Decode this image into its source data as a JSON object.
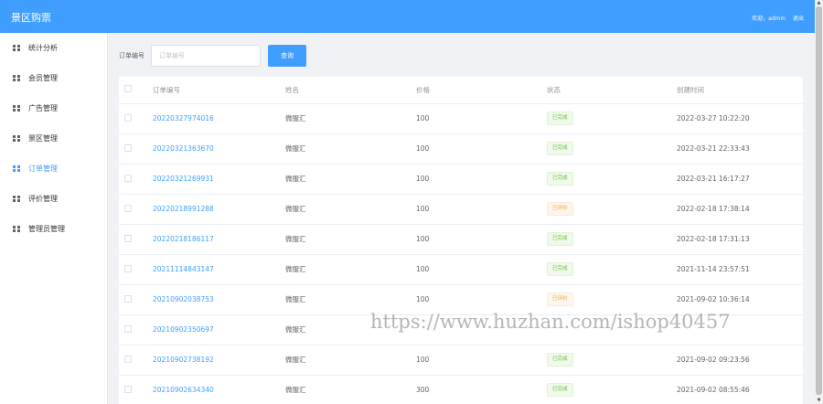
{
  "header": {
    "app_title": "景区购票",
    "welcome": "欢迎，admin",
    "logout": "退出"
  },
  "sidebar": {
    "items": [
      {
        "label": "统计分析",
        "icon": "grid-icon",
        "active": false
      },
      {
        "label": "会员管理",
        "icon": "grid-icon",
        "active": false
      },
      {
        "label": "广告管理",
        "icon": "grid-icon",
        "active": false
      },
      {
        "label": "景区管理",
        "icon": "grid-icon",
        "active": false
      },
      {
        "label": "订单管理",
        "icon": "grid-icon",
        "active": true
      },
      {
        "label": "评价管理",
        "icon": "grid-icon",
        "active": false
      },
      {
        "label": "管理员管理",
        "icon": "grid-icon",
        "active": false
      }
    ]
  },
  "search": {
    "label": "订单编号",
    "placeholder": "订单编号",
    "value": "",
    "button_label": "查询"
  },
  "table": {
    "columns": [
      "订单编号",
      "姓名",
      "价格",
      "状态",
      "创建时间"
    ],
    "rows": [
      {
        "order_no": "20220327974016",
        "name": "微服汇",
        "price": "100",
        "status": "已完成",
        "status_type": "done",
        "created": "2022-03-27 10:22:20"
      },
      {
        "order_no": "20220321363670",
        "name": "微服汇",
        "price": "100",
        "status": "已完成",
        "status_type": "done",
        "created": "2022-03-21 22:33:43"
      },
      {
        "order_no": "20220321269931",
        "name": "微服汇",
        "price": "100",
        "status": "已完成",
        "status_type": "done",
        "created": "2022-03-21 16:17:27"
      },
      {
        "order_no": "20220218991288",
        "name": "微服汇",
        "price": "100",
        "status": "已评价",
        "status_type": "reviewed",
        "created": "2022-02-18 17:38:14"
      },
      {
        "order_no": "20220218186117",
        "name": "微服汇",
        "price": "100",
        "status": "已完成",
        "status_type": "done",
        "created": "2022-02-18 17:31:13"
      },
      {
        "order_no": "20211114843147",
        "name": "微服汇",
        "price": "100",
        "status": "已完成",
        "status_type": "done",
        "created": "2021-11-14 23:57:51"
      },
      {
        "order_no": "20210902038753",
        "name": "微服汇",
        "price": "100",
        "status": "已评价",
        "status_type": "reviewed",
        "created": "2021-09-02 10:36:14"
      },
      {
        "order_no": "20210902350697",
        "name": "微服汇",
        "price": "",
        "status": "",
        "status_type": "done",
        "created": ""
      },
      {
        "order_no": "20210902738192",
        "name": "微服汇",
        "price": "100",
        "status": "已完成",
        "status_type": "done",
        "created": "2021-09-02 09:23:56"
      },
      {
        "order_no": "20210902634340",
        "name": "微服汇",
        "price": "300",
        "status": "已完成",
        "status_type": "done",
        "created": "2021-09-02 08:55:46"
      }
    ]
  },
  "watermark": "https://www.huzhan.com/ishop40457",
  "colors": {
    "primary": "#409eff",
    "success": "#67c23a",
    "warning": "#e6a23c"
  }
}
